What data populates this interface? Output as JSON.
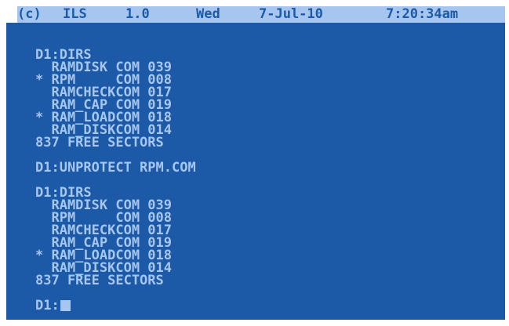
{
  "colors": {
    "screen_background": "#1c5aa8",
    "text": "#a6c6ef",
    "status_bar_background": "#a6c6ef",
    "status_bar_text": "#1c5aa8",
    "border": "#ffffff"
  },
  "status_bar": {
    "copyright": "(c)",
    "program": "ILS",
    "version": "1.0",
    "weekday": "Wed",
    "date": "7-Jul-10",
    "time": "7:20:34am"
  },
  "terminal": {
    "lines": [
      "D1:DIRS",
      "  RAMDISK COM 039",
      "* RPM     COM 008",
      "  RAMCHECKCOM 017",
      "  RAM_CAP COM 019",
      "* RAM_LOADCOM 018",
      "  RAM_DISKCOM 014",
      "837 FREE SECTORS",
      "",
      "D1:UNPROTECT RPM.COM",
      "",
      "D1:DIRS",
      "  RAMDISK COM 039",
      "  RPM     COM 008",
      "  RAMCHECKCOM 017",
      "  RAM_CAP COM 019",
      "* RAM_LOADCOM 018",
      "  RAM_DISKCOM 014",
      "837 FREE SECTORS",
      ""
    ],
    "prompt": "D1:"
  }
}
